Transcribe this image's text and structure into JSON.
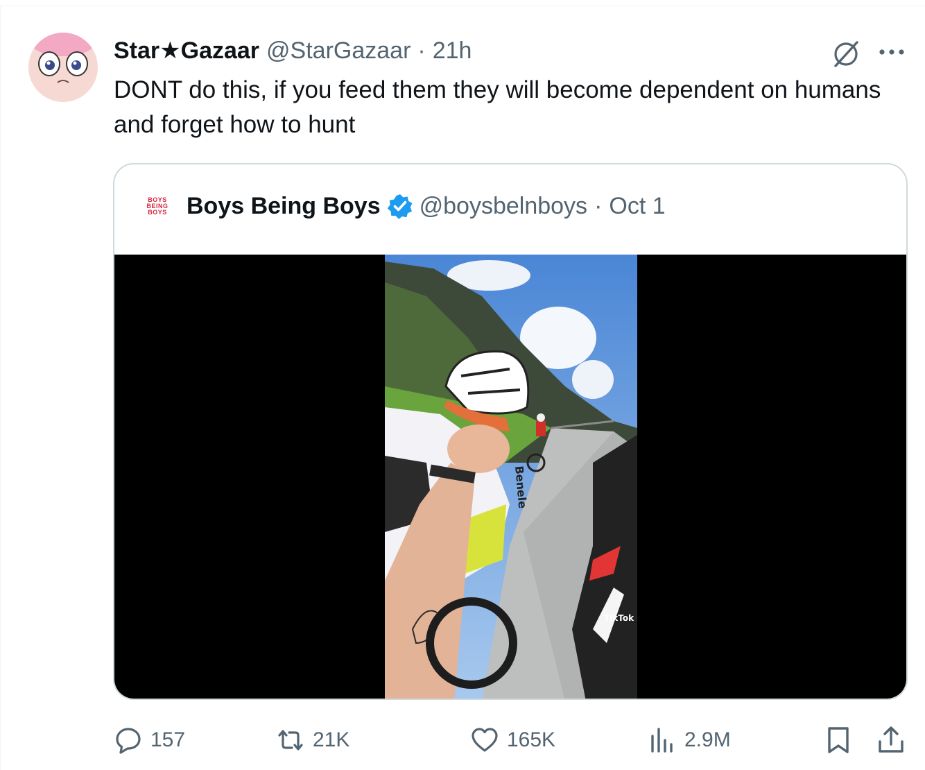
{
  "tweet": {
    "author_name": "Star★Gazaar",
    "handle": "@StarGazaar",
    "separator": "·",
    "time": "21h",
    "text": "DONT do this, if you feed them they will become dependent on humans and forget how to hunt"
  },
  "quote": {
    "logo_lines": [
      "BOYS",
      "BEING",
      "BOYS"
    ],
    "author_name": "Boys Being Boys",
    "handle": "@boysbelnboys",
    "separator": "·",
    "date": "Oct 1",
    "media_overlay": {
      "jersey_text": "Benele",
      "watermark": "TikTok"
    }
  },
  "actions": {
    "replies": "157",
    "reposts": "21K",
    "likes": "165K",
    "views": "2.9M"
  },
  "colors": {
    "text_primary": "#0f1419",
    "text_secondary": "#536471",
    "border": "#cfd9de",
    "verified_blue": "#1d9bf0",
    "logo_red": "#d7263d"
  },
  "icons": [
    "grok-icon",
    "more-icon",
    "verified-badge-icon",
    "reply-icon",
    "repost-icon",
    "like-icon",
    "views-icon",
    "bookmark-icon",
    "share-icon"
  ]
}
